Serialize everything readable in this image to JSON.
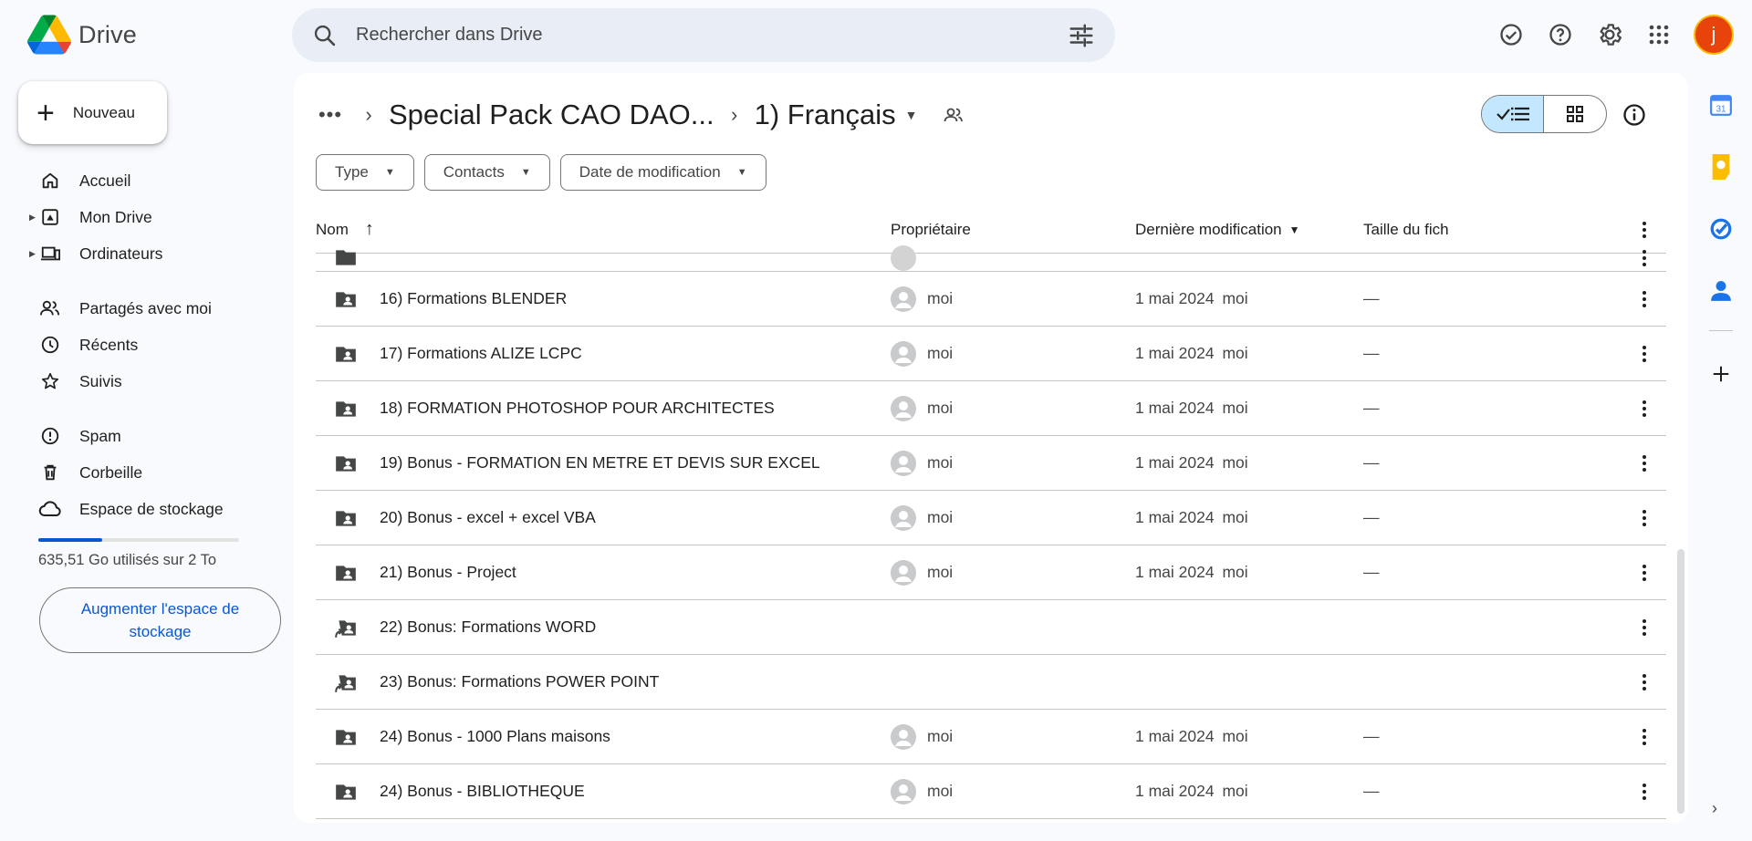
{
  "app": {
    "name": "Drive"
  },
  "search": {
    "placeholder": "Rechercher dans Drive"
  },
  "account": {
    "initial": "j"
  },
  "sidebar": {
    "new_label": "Nouveau",
    "items": [
      {
        "label": "Accueil",
        "icon": "home-icon"
      },
      {
        "label": "Mon Drive",
        "icon": "my-drive-icon"
      },
      {
        "label": "Ordinateurs",
        "icon": "computers-icon"
      },
      {
        "label": "Partagés avec moi",
        "icon": "shared-icon"
      },
      {
        "label": "Récents",
        "icon": "clock-icon"
      },
      {
        "label": "Suivis",
        "icon": "star-icon"
      },
      {
        "label": "Spam",
        "icon": "spam-icon"
      },
      {
        "label": "Corbeille",
        "icon": "trash-icon"
      },
      {
        "label": "Espace de stockage",
        "icon": "cloud-icon"
      }
    ],
    "storage_text": "635,51 Go utilisés sur 2 To",
    "storage_fraction": 0.318,
    "upgrade_label": "Augmenter l'espace de stockage"
  },
  "breadcrumb": {
    "parent": "Special Pack CAO DAO...",
    "current": "1) Français"
  },
  "filters": [
    "Type",
    "Contacts",
    "Date de modification"
  ],
  "table": {
    "headers": {
      "name": "Nom",
      "owner": "Propriétaire",
      "modified": "Dernière modification",
      "size": "Taille du fich"
    },
    "rows": [
      {
        "name": "16) Formations BLENDER",
        "owner": "moi",
        "date": "1 mai 2024",
        "by": "moi",
        "size": "—",
        "shortcut": false
      },
      {
        "name": "17) Formations ALIZE LCPC",
        "owner": "moi",
        "date": "1 mai 2024",
        "by": "moi",
        "size": "—",
        "shortcut": false
      },
      {
        "name": "18) FORMATION PHOTOSHOP POUR ARCHITECTES",
        "owner": "moi",
        "date": "1 mai 2024",
        "by": "moi",
        "size": "—",
        "shortcut": false
      },
      {
        "name": "19) Bonus - FORMATION EN METRE ET DEVIS SUR EXCEL",
        "owner": "moi",
        "date": "1 mai 2024",
        "by": "moi",
        "size": "—",
        "shortcut": false
      },
      {
        "name": "20) Bonus - excel + excel VBA",
        "owner": "moi",
        "date": "1 mai 2024",
        "by": "moi",
        "size": "—",
        "shortcut": false
      },
      {
        "name": "21) Bonus - Project",
        "owner": "moi",
        "date": "1 mai 2024",
        "by": "moi",
        "size": "—",
        "shortcut": false
      },
      {
        "name": "22) Bonus: Formations WORD",
        "owner": "",
        "date": "",
        "by": "",
        "size": "",
        "shortcut": true
      },
      {
        "name": "23) Bonus: Formations POWER POINT",
        "owner": "",
        "date": "",
        "by": "",
        "size": "",
        "shortcut": true
      },
      {
        "name": "24) Bonus - 1000 Plans maisons",
        "owner": "moi",
        "date": "1 mai 2024",
        "by": "moi",
        "size": "—",
        "shortcut": false
      },
      {
        "name": "24) Bonus - BIBLIOTHEQUE",
        "owner": "moi",
        "date": "1 mai 2024",
        "by": "moi",
        "size": "—",
        "shortcut": false
      }
    ]
  },
  "colors": {
    "accent": "#0b57d0",
    "toggle_active": "#c2e7ff",
    "background": "#f8fafd"
  }
}
